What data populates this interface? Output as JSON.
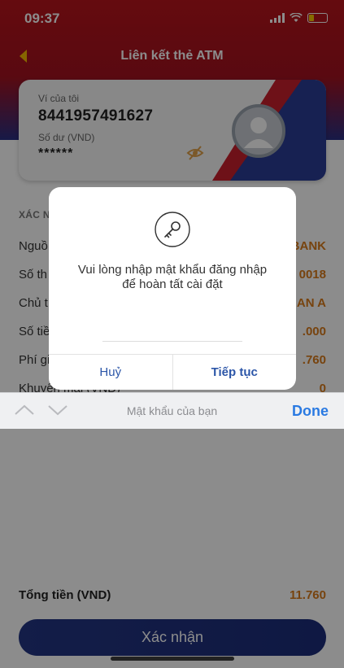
{
  "status_bar": {
    "time": "09:37"
  },
  "nav": {
    "title": "Liên kết thẻ ATM"
  },
  "wallet_card": {
    "label": "Ví của tôi",
    "account_number": "8441957491627",
    "balance_label": "Số dư (VND)",
    "balance_masked": "******"
  },
  "details": {
    "section_title": "XÁC N",
    "rows": [
      {
        "label": "Nguồ",
        "value": "BANK"
      },
      {
        "label": "Số th",
        "value": "0018"
      },
      {
        "label": "Chủ t",
        "value": "AN A"
      },
      {
        "label": "Số tiề",
        "value": ".000"
      },
      {
        "label": "Phí gi",
        "value": ".760"
      },
      {
        "label": "Khuyến mãi (VND)",
        "value": "0"
      }
    ]
  },
  "total": {
    "label": "Tổng tiền (VND)",
    "value": "11.760"
  },
  "confirm_button": "Xác nhận",
  "dialog": {
    "message_line1": "Vui lòng nhập mật khẩu đăng nhập",
    "message_line2": "để hoàn tất cài đặt",
    "password_value": "",
    "cancel_label": "Huỷ",
    "continue_label": "Tiếp tục"
  },
  "keyboard_toolbar": {
    "placeholder_hint": "Mật khẩu của bạn",
    "done_label": "Done"
  },
  "colors": {
    "brand_red": "#b8141c",
    "brand_navy": "#233583",
    "accent_orange": "#d97b1a",
    "link_blue": "#2a7ae2"
  }
}
